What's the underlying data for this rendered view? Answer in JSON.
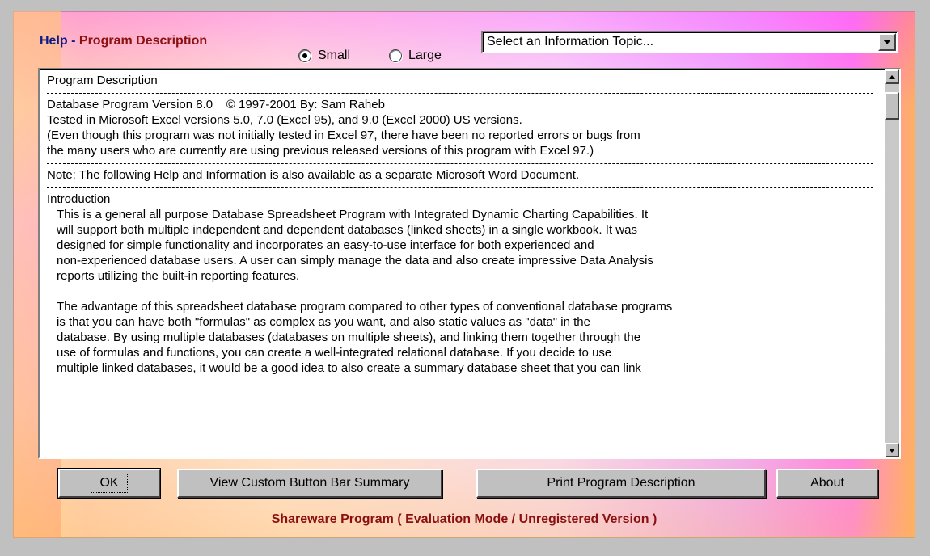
{
  "header": {
    "title_prefix": "Help - ",
    "title_main": "Program Description"
  },
  "view_size": {
    "options": [
      "Small",
      "Large"
    ],
    "selected": "Small"
  },
  "topic_select": {
    "value": "Select an Information Topic..."
  },
  "content": {
    "heading": "Program Description",
    "version_lines": [
      "Database Program Version 8.0    © 1997-2001 By: Sam Raheb",
      "Tested in Microsoft Excel versions 5.0, 7.0 (Excel 95), and 9.0 (Excel 2000) US versions.",
      "(Even though this program was not initially tested in Excel 97, there have been no reported errors or bugs from",
      "the many users who are currently are using previous released versions of this program with Excel 97.)"
    ],
    "note": "Note: The following Help and Information is also available as a separate Microsoft Word Document.",
    "intro_heading": "Introduction",
    "intro_lines": [
      "This is a general all purpose Database Spreadsheet Program with Integrated Dynamic Charting Capabilities. It",
      "will support both multiple independent and dependent databases (linked sheets) in a single workbook. It was",
      "designed for simple functionality and incorporates an easy-to-use interface for both experienced and",
      "non-experienced database users. A user can simply manage the data and also create impressive Data Analysis",
      "reports utilizing the built-in reporting features."
    ],
    "adv_lines": [
      "The advantage of this spreadsheet database program compared to other types of conventional database programs",
      "is that you can have both \"formulas\" as complex as you want, and also static values as \"data\" in the",
      "database. By using multiple databases (databases on multiple sheets), and linking them together through the",
      "use of formulas and functions, you can create a well-integrated relational database. If you decide to use",
      "multiple linked databases, it would be a good idea to also create a summary database sheet that you can link"
    ]
  },
  "buttons": {
    "ok": "OK",
    "view_summary": "View Custom Button Bar Summary",
    "print": "Print Program Description",
    "about": "About"
  },
  "footer": {
    "status": "Shareware Program ( Evaluation Mode / Unregistered Version )"
  }
}
